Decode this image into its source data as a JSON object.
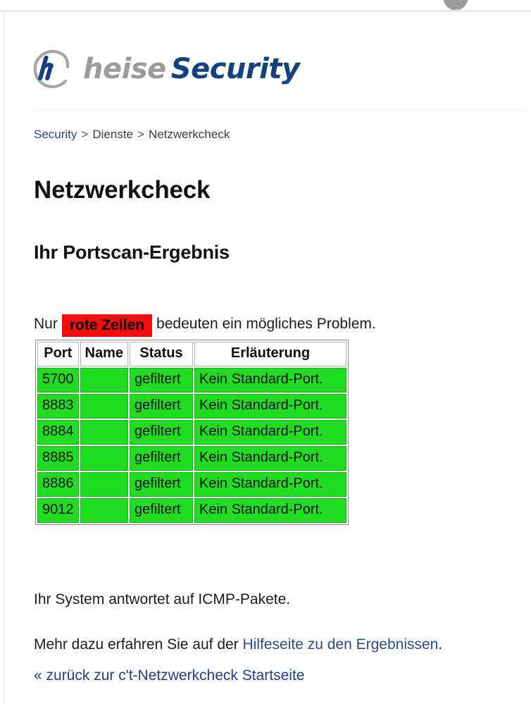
{
  "browser_chrome": {
    "avatar_icon": "account-circle-icon"
  },
  "site": {
    "logo_mark_icon": "heise-circle-h-icon",
    "logo_word_primary": "heise",
    "logo_word_secondary": "Security",
    "brand_gray": "#9b9b9b",
    "brand_blue": "#14417f"
  },
  "breadcrumb": {
    "items": [
      {
        "label": "Security",
        "is_link": true
      },
      {
        "label": "Dienste",
        "is_link": false
      },
      {
        "label": "Netzwerkcheck",
        "is_link": false
      }
    ],
    "separator": ">"
  },
  "page": {
    "title": "Netzwerkcheck",
    "section_title": "Ihr Portscan-Ergebnis"
  },
  "legend": {
    "prefix": "Nur",
    "chip_label": "rote Zeilen",
    "suffix": "bedeuten ein mögliches Problem.",
    "chip_bg": "#f50c0c",
    "chip_fg": "#000000"
  },
  "results_table": {
    "columns": [
      "Port",
      "Name",
      "Status",
      "Erläuterung"
    ],
    "row_ok_color": "#21dd21",
    "row_bad_color": "#f50c0c",
    "rows": [
      {
        "port": "5700",
        "name": "",
        "status": "gefiltert",
        "explanation": "Kein Standard-Port.",
        "state": "ok"
      },
      {
        "port": "8883",
        "name": "",
        "status": "gefiltert",
        "explanation": "Kein Standard-Port.",
        "state": "ok"
      },
      {
        "port": "8884",
        "name": "",
        "status": "gefiltert",
        "explanation": "Kein Standard-Port.",
        "state": "ok"
      },
      {
        "port": "8885",
        "name": "",
        "status": "gefiltert",
        "explanation": "Kein Standard-Port.",
        "state": "ok"
      },
      {
        "port": "8886",
        "name": "",
        "status": "gefiltert",
        "explanation": "Kein Standard-Port.",
        "state": "ok"
      },
      {
        "port": "9012",
        "name": "",
        "status": "gefiltert",
        "explanation": "Kein Standard-Port.",
        "state": "ok"
      }
    ]
  },
  "footer": {
    "icmp_note": "Ihr System antwortet auf ICMP-Pakete.",
    "help_prefix": "Mehr dazu erfahren Sie auf der",
    "help_link": "Hilfeseite zu den Ergebnissen",
    "help_suffix": ".",
    "back_link": "« zurück zur c't-Netzwerkcheck Startseite"
  }
}
